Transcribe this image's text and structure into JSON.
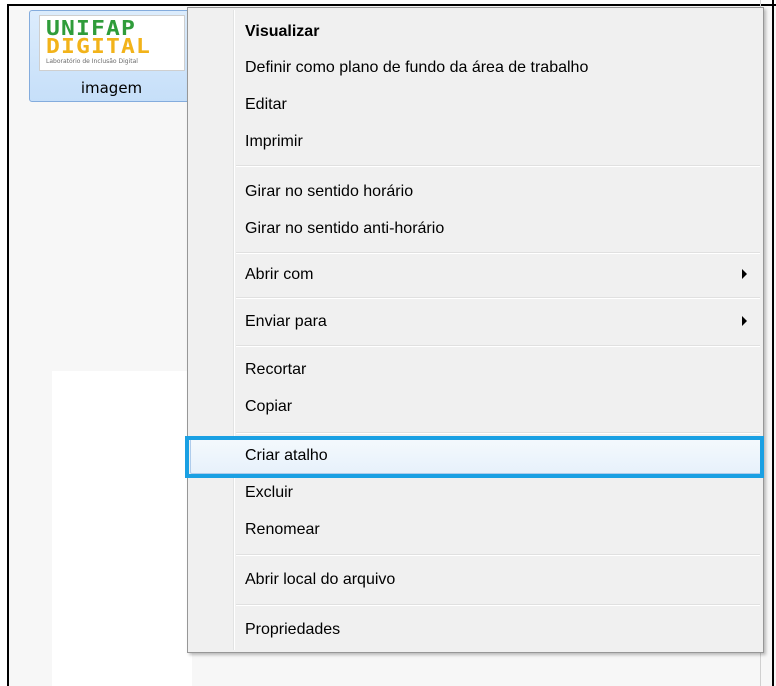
{
  "desktop": {
    "file": {
      "name": "imagem",
      "thumbnail": {
        "logo_line1": "UNIFAP",
        "logo_line2": "DIGITAL",
        "logo_sub": "Laboratório de Inclusão Digital"
      }
    }
  },
  "context_menu": {
    "items": [
      {
        "label": "Visualizar",
        "bold": true
      },
      {
        "label": "Definir como plano de fundo da área de trabalho"
      },
      {
        "label": "Editar"
      },
      {
        "label": "Imprimir"
      },
      {
        "label": "Girar no sentido horário"
      },
      {
        "label": "Girar no sentido anti-horário"
      },
      {
        "label": "Abrir com",
        "submenu": true
      },
      {
        "label": "Enviar para",
        "submenu": true
      },
      {
        "label": "Recortar"
      },
      {
        "label": "Copiar"
      },
      {
        "label": "Criar atalho",
        "highlighted": true
      },
      {
        "label": "Excluir"
      },
      {
        "label": "Renomear"
      },
      {
        "label": "Abrir local do arquivo"
      },
      {
        "label": "Propriedades"
      }
    ]
  },
  "colors": {
    "highlight_border": "#1aa0e3",
    "logo_green": "#2f9c3a",
    "logo_yellow": "#f2b31a"
  },
  "icons": [
    "submenu-arrow-icon"
  ]
}
